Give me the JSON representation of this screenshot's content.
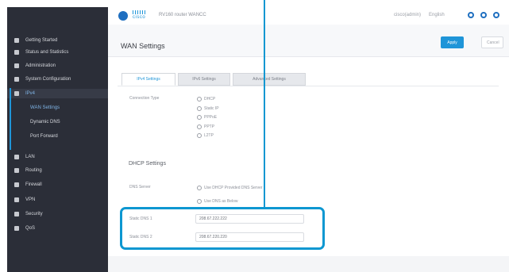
{
  "sidebar": {
    "items": [
      {
        "label": "Getting Started"
      },
      {
        "label": "Status and Statistics"
      },
      {
        "label": "Administration"
      },
      {
        "label": "System Configuration"
      },
      {
        "label": "IPv4"
      },
      {
        "label": "WAN Settings"
      },
      {
        "label": "Dynamic DNS"
      },
      {
        "label": "Port Forward"
      },
      {
        "label": "LAN"
      },
      {
        "label": "Routing"
      },
      {
        "label": "Firewall"
      },
      {
        "label": "VPN"
      },
      {
        "label": "Security"
      },
      {
        "label": "QoS"
      }
    ]
  },
  "header": {
    "brand": "cisco",
    "model": "RV160 router WANCC",
    "user": "cisco(admin)",
    "start": "English"
  },
  "page": {
    "title": "WAN Settings",
    "apply_label": "Apply",
    "cancel_label": "Cancel"
  },
  "tabs": [
    {
      "label": "IPv4 Settings"
    },
    {
      "label": "IPv6 Settings"
    },
    {
      "label": "Advanced Settings"
    }
  ],
  "form": {
    "connection_type_label": "Connection Type",
    "connection_options": [
      "DHCP",
      "Static IP",
      "PPPoE",
      "PPTP",
      "L2TP"
    ],
    "dhcp_section_title": "DHCP Settings",
    "dns_server_label": "DNS Server",
    "dns_options": [
      "Use DHCP Provided DNS Server",
      "Use DNS as Below"
    ],
    "dns1_label": "Static DNS 1",
    "dns2_label": "Static DNS 2",
    "dns1_value": "208.67.222.222",
    "dns2_value": "208.67.220.220"
  },
  "colors": {
    "accent": "#1f95d8",
    "highlight": "#0d97d1",
    "sidebar_bg": "#2b2e38"
  }
}
